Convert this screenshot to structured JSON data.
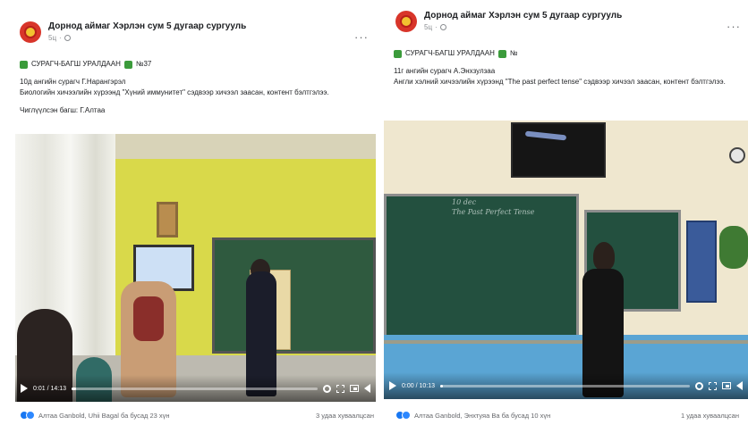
{
  "posts": [
    {
      "page_name": "Дорнод аймаг Хэрлэн сум 5 дугаар сургууль",
      "time": "5ц",
      "tag_label": "СУРАГЧ-БАГШ УРАЛДААН",
      "tag_suffix": "№37",
      "body_line1": "10д ангийн сурагч Г.Нарангэрэл",
      "body_line2": "Биологийн хичээлийн хүрээнд \"Хүний иммунитет\" сэдвээр хичээл заасан, контент бэлтгэлээ.",
      "teacher_line": "Чиглүүлсэн багш: Г.Алтаа",
      "video_time": "0:01 / 14:13",
      "progress": 0.02,
      "reactors": "Алтаа Ganbold, Uhii Bagal ба бусад 23 хүн",
      "shares": "3 удаа хуваалцсан"
    },
    {
      "page_name": "Дорнод аймаг Хэрлэн сум 5 дугаар сургууль",
      "time": "5ц",
      "tag_label": "СУРАГЧ-БАГШ УРАЛДААН",
      "tag_suffix": "№",
      "body_line1": "11г ангийн сурагч А.Энхзулзаа",
      "body_line2": "Англи хэлний хичээлийн хүрээнд \"The past perfect tense\" сэдвээр хичээл заасан, контент бэлтгэлээ.",
      "teacher_line": "",
      "video_time": "0:00 / 10:13",
      "progress": 0.01,
      "reactors": "Алтаа Ganbold, Энхтуяа Ba ба бусад 10 хүн",
      "shares": "1 удаа хуваалцсан"
    }
  ],
  "board_text": {
    "line1": "10 dec",
    "line2": "The Past Perfect Tense"
  },
  "colors": {
    "brand_red": "#d8352a",
    "like_blue": "#1877f2",
    "text_secondary": "#65676b"
  },
  "icons": {
    "avatar": "school-emblem",
    "privacy": "globe-icon",
    "more": "more-options-icon",
    "tag": "green-flag-icon",
    "controls": [
      "play-icon",
      "gear-icon",
      "expand-icon",
      "pip-icon",
      "volume-icon"
    ],
    "reactions": [
      "like-icon",
      "heart-icon"
    ]
  }
}
